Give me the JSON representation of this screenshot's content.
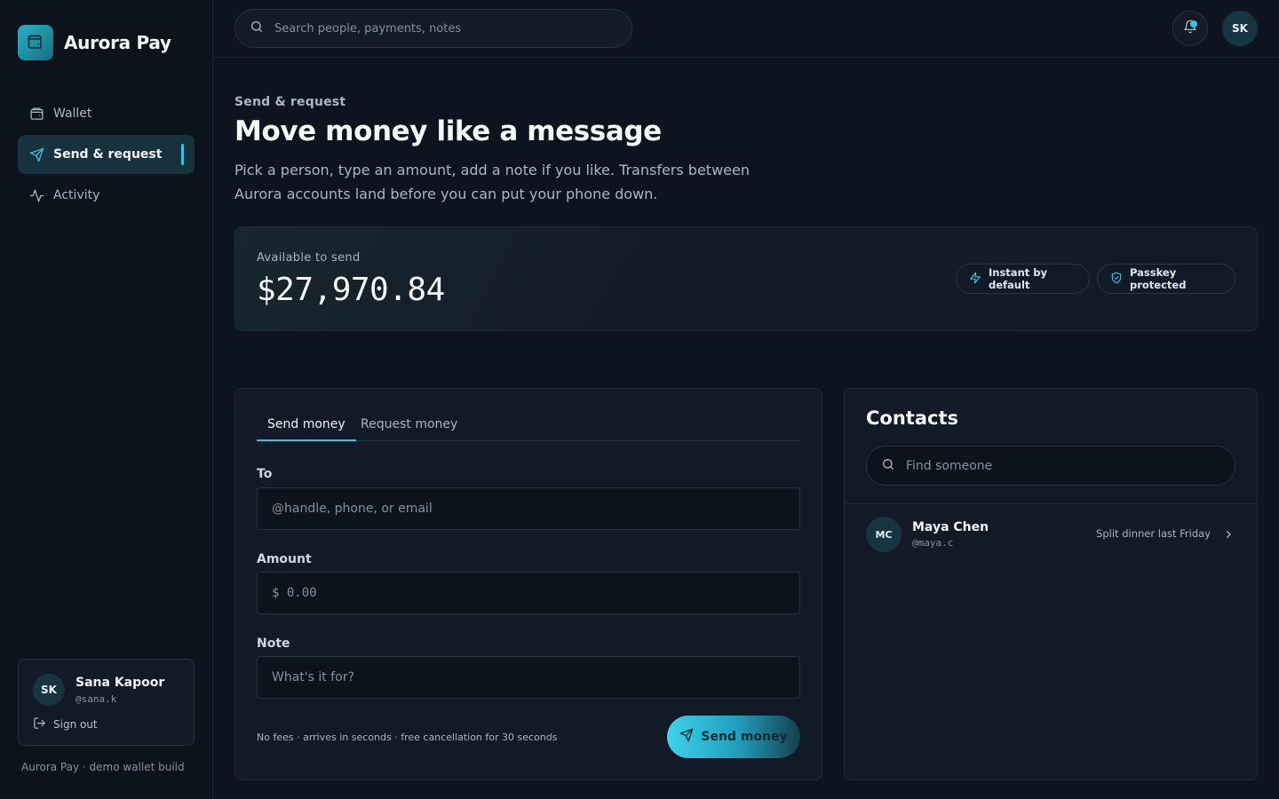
{
  "app": {
    "name": "Aurora Pay",
    "build_note": "Aurora Pay · demo wallet build"
  },
  "colors": {
    "accent": "#33c6e6",
    "background": "#0d1420",
    "card": "#111a26"
  },
  "sidebar": {
    "items": [
      {
        "label": "Wallet",
        "icon": "wallet-icon",
        "active": false
      },
      {
        "label": "Send & request",
        "icon": "send-icon",
        "active": true
      },
      {
        "label": "Activity",
        "icon": "activity-icon",
        "active": false
      }
    ],
    "user": {
      "initials": "SK",
      "name": "Sana Kapoor",
      "handle": "@sana.k",
      "sign_out": "Sign out"
    }
  },
  "topbar": {
    "search_placeholder": "Search people, payments, notes",
    "avatar_initials": "SK"
  },
  "header": {
    "eyebrow": "Send & request",
    "title": "Move money like a message",
    "subtitle": "Pick a person, type an amount, add a note if you like. Transfers between Aurora accounts land before you can put your phone down."
  },
  "balance": {
    "label": "Available to send",
    "amount": "$27,970.84",
    "badges": [
      "Instant by default",
      "Passkey protected"
    ]
  },
  "form": {
    "tabs": [
      "Send money",
      "Request money"
    ],
    "active_tab": "Send money",
    "to": {
      "label": "To",
      "placeholder": "@handle, phone, or email",
      "value": ""
    },
    "amount": {
      "label": "Amount",
      "placeholder": "$ 0.00",
      "value": ""
    },
    "note": {
      "label": "Note",
      "placeholder": "What's it for?",
      "value": ""
    },
    "footnote": "No fees · arrives in seconds · free cancellation for 30 seconds",
    "submit_label": "Send money"
  },
  "contacts": {
    "title": "Contacts",
    "search_placeholder": "Find someone",
    "items": [
      {
        "initials": "MC",
        "name": "Maya Chen",
        "handle": "@maya.c",
        "note": "Split dinner last Friday"
      }
    ]
  }
}
